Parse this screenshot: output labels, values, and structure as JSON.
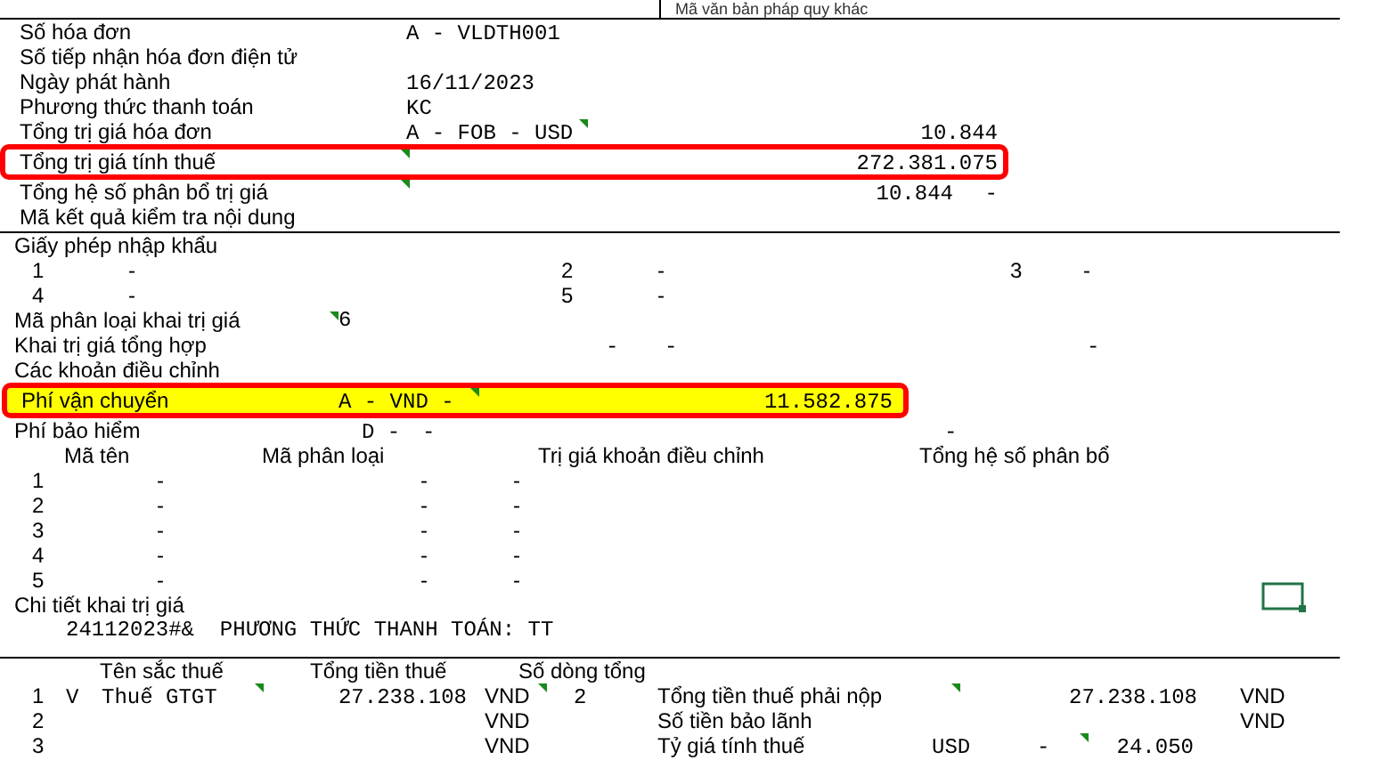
{
  "header_note": "Mã văn bản pháp quy khác",
  "invoice_fields": [
    {
      "label": "Số hóa đơn",
      "value": "A - VLDTH001",
      "highlighted": false
    },
    {
      "label": "Số tiếp nhận hóa đơn điện tử",
      "highlighted": false
    },
    {
      "label": "Ngày phát hành",
      "value": "16/11/2023",
      "highlighted": false
    },
    {
      "label": "Phương thức thanh toán",
      "value": "KC",
      "highlighted": false
    },
    {
      "label": "Tổng trị giá hóa đơn",
      "value": "A - FOB - USD",
      "amount": "10.844",
      "highlighted": false
    },
    {
      "label": "Tổng trị giá tính thuế",
      "amount": "272.381.075",
      "highlighted": true
    },
    {
      "label": "Tổng hệ số phân bổ trị giá",
      "amount": "10.844",
      "suffix": "-",
      "highlighted": false
    },
    {
      "label": "Mã kết quả kiểm tra nội dung",
      "highlighted": false
    }
  ],
  "import_license": {
    "label": "Giấy phép nhập khẩu",
    "rows": [
      [
        {
          "number": "1",
          "value": "-"
        },
        {
          "number": "2",
          "value": "-"
        },
        {
          "number": "3",
          "value": "-"
        }
      ],
      [
        {
          "number": "4",
          "value": "-"
        },
        {
          "number": "5",
          "value": "-"
        }
      ]
    ]
  },
  "valuation_method": {
    "label": "Mã phân loại khai trị giá",
    "value": "6"
  },
  "combined_valuation": {
    "label": "Khai trị giá tổng hợp",
    "values": [
      "-",
      "-",
      "-"
    ]
  },
  "adjustments": {
    "label": "Các khoản điều chỉnh"
  },
  "freight": {
    "label": "Phí vận chuyển",
    "value": "A - VND -",
    "amount": "11.582.875",
    "highlighted": true,
    "filled": true
  },
  "insurance": {
    "label": "Phí bảo hiểm",
    "values": [
      "D -",
      "-",
      "-"
    ]
  },
  "adjustment_table": {
    "headings": [
      "Mã tên",
      "Mã phân loại",
      "Trị giá khoản điều chỉnh",
      "Tổng hệ số phân bổ"
    ],
    "entries": [
      {
        "number": "1",
        "dashes": [
          "-",
          "-",
          "-"
        ]
      },
      {
        "number": "2",
        "dashes": [
          "-",
          "-",
          "-"
        ]
      },
      {
        "number": "3",
        "dashes": [
          "-",
          "-",
          "-"
        ]
      },
      {
        "number": "4",
        "dashes": [
          "-",
          "-",
          "-"
        ]
      },
      {
        "number": "5",
        "dashes": [
          "-",
          "-",
          "-"
        ]
      }
    ]
  },
  "valuation_details": {
    "label": "Chi tiết khai trị giá",
    "text": "24112023#&  PHƯƠNG THỨC THANH TOÁN: TT"
  },
  "tax_table": {
    "columns": [
      "Tên sắc thuế",
      "Tổng tiền thuế",
      "Số dòng tổng"
    ],
    "rows": [
      {
        "number": "1",
        "code": "V",
        "name": "Thuế GTGT",
        "amount": "27.238.108",
        "currency": "VND",
        "lines": "2",
        "summary_label": "Tổng tiền thuế phải nộp",
        "summary_value": "27.238.108",
        "summary_unit": "VND"
      },
      {
        "number": "2",
        "currency": "VND",
        "summary_label": "Số tiền bảo lãnh",
        "summary_unit": "VND"
      },
      {
        "number": "3",
        "currency": "VND",
        "summary_label": "Tỷ giá tính thuế",
        "summary_currency": "USD",
        "summary_dash": "-",
        "summary_value": "24.050"
      }
    ]
  }
}
